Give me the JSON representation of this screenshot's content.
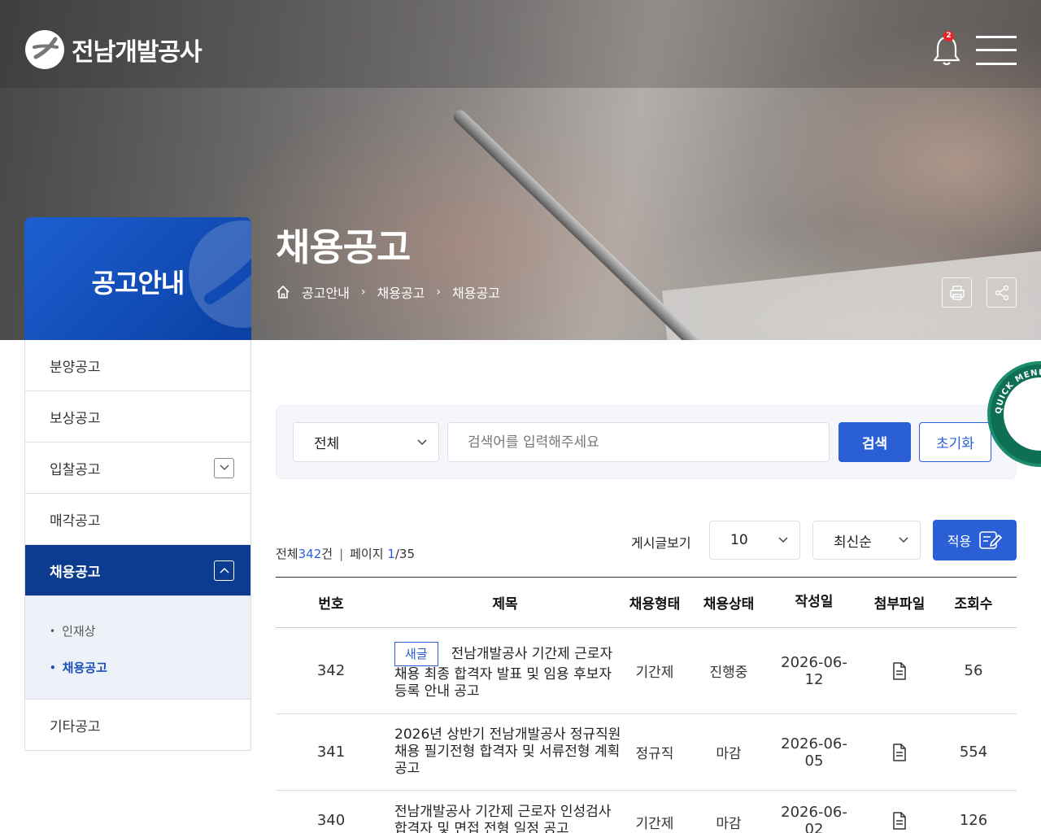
{
  "brand": {
    "name": "전남개발공사"
  },
  "header": {
    "notification_count": "2"
  },
  "hero": {
    "title": "채용공고",
    "breadcrumb": [
      "공고안내",
      "채용공고",
      "채용공고"
    ]
  },
  "sidebar": {
    "title": "공고안내",
    "items": [
      {
        "label": "분양공고"
      },
      {
        "label": "보상공고"
      },
      {
        "label": "입찰공고"
      },
      {
        "label": "매각공고"
      },
      {
        "label": "채용공고"
      },
      {
        "label": "기타공고"
      }
    ],
    "sub_items": [
      {
        "label": "인재상"
      },
      {
        "label": "채용공고"
      }
    ]
  },
  "search": {
    "category": "전체",
    "placeholder": "검색어를 입력해주세요",
    "search_label": "검색",
    "reset_label": "초기화"
  },
  "quick_menu": {
    "label": "QUICK MENU SERVICE"
  },
  "list_info": {
    "total_prefix": "전체",
    "total": "342",
    "total_suffix": "건",
    "page_prefix": "페이지",
    "page_current": "1",
    "page_total": "/35",
    "view_label": "게시글보기",
    "page_size": "10",
    "sort": "최신순",
    "apply_label": "적용"
  },
  "table": {
    "headers": [
      "번호",
      "제목",
      "채용형태",
      "채용상태",
      "작성일",
      "첨부파일",
      "조회수"
    ],
    "rows": [
      {
        "no": "342",
        "badge": "새글",
        "title": "전남개발공사 기간제 근로자 채용 최종 합격자 발표 및 임용 후보자 등록 안내 공고",
        "type": "기간제",
        "status": "진행중",
        "date": "2026-06-12",
        "views": "56"
      },
      {
        "no": "341",
        "badge": "",
        "title": "2026년 상반기 전남개발공사 정규직원 채용 필기전형 합격자 및 서류전형 계획 공고",
        "type": "정규직",
        "status": "마감",
        "date": "2026-06-05",
        "views": "554"
      },
      {
        "no": "340",
        "badge": "",
        "title": "전남개발공사 기간제 근로자 인성검사 합격자 및 면접 전형 일정 공고",
        "type": "기간제",
        "status": "마감",
        "date": "2026-06-02",
        "views": "126"
      }
    ]
  },
  "colors": {
    "primary": "#2b5fd6",
    "nav_active": "#0b3c8f",
    "quick": "#0e6f55"
  }
}
